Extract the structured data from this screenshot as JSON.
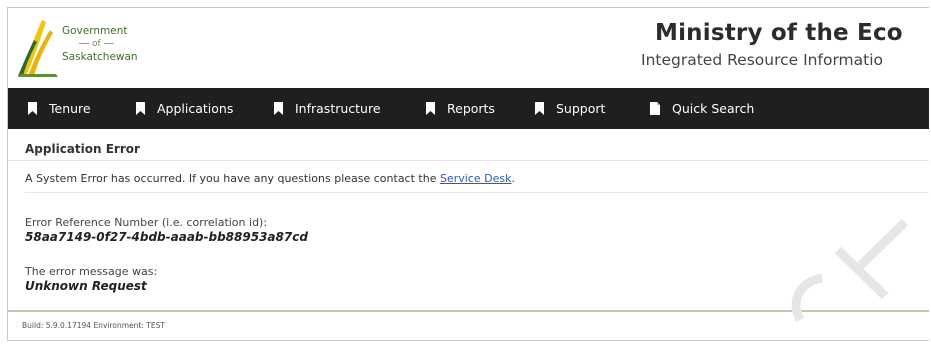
{
  "logo": {
    "line1": "Government",
    "line2": "of",
    "line3": "Saskatchewan"
  },
  "header": {
    "title": "Ministry of the Eco",
    "subtitle": "Integrated Resource Informatio"
  },
  "nav": {
    "items": [
      {
        "label": "Tenure",
        "icon": "bookmark-icon"
      },
      {
        "label": "Applications",
        "icon": "bookmark-icon"
      },
      {
        "label": "Infrastructure",
        "icon": "bookmark-icon"
      },
      {
        "label": "Reports",
        "icon": "bookmark-icon"
      },
      {
        "label": "Support",
        "icon": "bookmark-icon"
      },
      {
        "label": "Quick Search",
        "icon": "document-icon"
      }
    ]
  },
  "error": {
    "title": "Application Error",
    "message_prefix": "A System Error has occurred. If you have any questions please contact the ",
    "link_text": "Service Desk",
    "message_suffix": ".",
    "ref_label": "Error Reference Number (i.e. correlation id):",
    "ref_value": "58aa7149-0f27-4bdb-aaab-bb88953a87cd",
    "msg_label": "The error message was:",
    "msg_value": "Unknown Request"
  },
  "footer": {
    "build_text": "Build: 5.9.0.17194 Environment: TEST"
  },
  "colors": {
    "navbar_bg": "#1f1f1f",
    "link": "#2a5db0",
    "logo_green": "#3e6f2b",
    "logo_yellow": "#f2c40f"
  }
}
